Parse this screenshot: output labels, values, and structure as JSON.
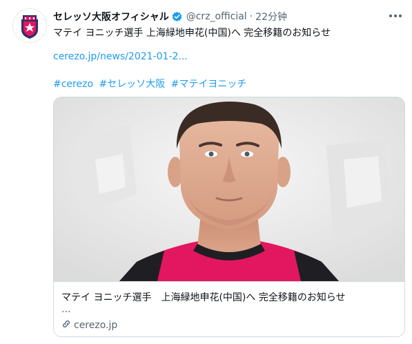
{
  "account": {
    "display_name": "セレッソ大阪オフィシャル",
    "handle": "@crz_official",
    "separator": "·",
    "time": "22分钟"
  },
  "tweet": {
    "text": "マテイ ヨニッチ選手 上海緑地申花(中国)へ 完全移籍のお知らせ",
    "link": "cerezo.jp/news/2021-01-2...",
    "hashtags": [
      "#cerezo",
      "#セレッソ大阪",
      "#マテイヨニッチ"
    ]
  },
  "card": {
    "title": "マテイ ヨニッチ選手　上海緑地申花(中国)へ 完全移籍のお知らせ",
    "description": "...",
    "domain": "cerezo.jp"
  },
  "icons": {
    "verified": "verified-badge-icon",
    "more": "more-options-icon",
    "link": "link-icon"
  },
  "colors": {
    "accent": "#1d9bf0",
    "muted": "#536471",
    "border": "#cfd9de",
    "jersey": "#e2175f"
  }
}
